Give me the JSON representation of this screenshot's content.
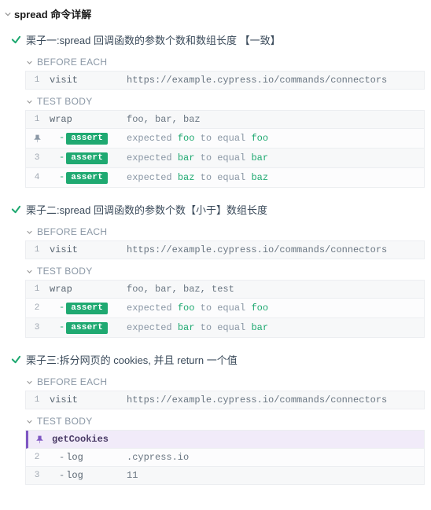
{
  "suite": {
    "title": "spread 命令详解"
  },
  "tests": [
    {
      "title": "栗子一:spread 回调函数的参数个数和数组长度 【一致】",
      "sections": [
        {
          "label": "BEFORE EACH",
          "rows": [
            {
              "n": "1",
              "cmd": "visit",
              "msg_plain": "https://example.cypress.io/commands/connectors"
            }
          ]
        },
        {
          "label": "TEST BODY",
          "rows": [
            {
              "n": "1",
              "cmd": "wrap",
              "msg_plain": "foo, bar, baz"
            },
            {
              "n": "pin",
              "cmd": "assert",
              "assert": true,
              "msg_assert": {
                "a": "foo",
                "mid": "to equal",
                "b": "foo"
              }
            },
            {
              "n": "3",
              "cmd": "assert",
              "assert": true,
              "msg_assert": {
                "a": "bar",
                "mid": "to equal",
                "b": "bar"
              }
            },
            {
              "n": "4",
              "cmd": "assert",
              "assert": true,
              "msg_assert": {
                "a": "baz",
                "mid": "to equal",
                "b": "baz"
              }
            }
          ]
        }
      ]
    },
    {
      "title": "栗子二:spread 回调函数的参数个数【小于】数组长度",
      "sections": [
        {
          "label": "BEFORE EACH",
          "rows": [
            {
              "n": "1",
              "cmd": "visit",
              "msg_plain": "https://example.cypress.io/commands/connectors"
            }
          ]
        },
        {
          "label": "TEST BODY",
          "rows": [
            {
              "n": "1",
              "cmd": "wrap",
              "msg_plain": "foo, bar, baz, test"
            },
            {
              "n": "2",
              "cmd": "assert",
              "assert": true,
              "msg_assert": {
                "a": "foo",
                "mid": "to equal",
                "b": "foo"
              }
            },
            {
              "n": "3",
              "cmd": "assert",
              "assert": true,
              "msg_assert": {
                "a": "bar",
                "mid": "to equal",
                "b": "bar"
              }
            }
          ]
        }
      ]
    },
    {
      "title": "栗子三:拆分网页的 cookies, 并且 return 一个值",
      "sections": [
        {
          "label": "BEFORE EACH",
          "rows": [
            {
              "n": "1",
              "cmd": "visit",
              "msg_plain": "https://example.cypress.io/commands/connectors"
            }
          ]
        },
        {
          "label": "TEST BODY",
          "rows": [
            {
              "n": "pin-purple",
              "cmd": "getCookies",
              "pinned": true
            },
            {
              "n": "2",
              "cmd": "log",
              "child": true,
              "msg_plain": ".cypress.io"
            },
            {
              "n": "3",
              "cmd": "log",
              "child": true,
              "msg_plain": "11"
            }
          ]
        }
      ]
    }
  ]
}
